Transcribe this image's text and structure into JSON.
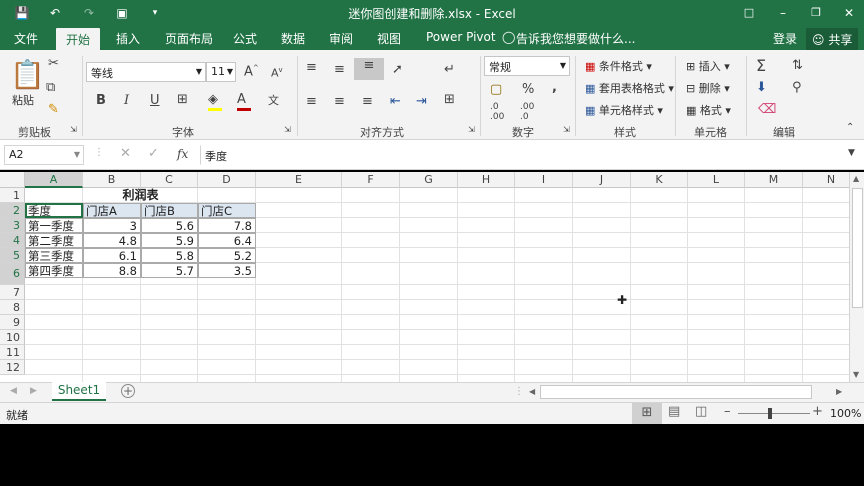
{
  "window": {
    "title": "迷你图创建和删除.xlsx - Excel"
  },
  "tabs": [
    "文件",
    "开始",
    "插入",
    "页面布局",
    "公式",
    "数据",
    "审阅",
    "视图",
    "Power Pivot"
  ],
  "tell_me": "告诉我您想要做什么...",
  "login": "登录",
  "share": "共享",
  "ribbon": {
    "clipboard": {
      "paste": "粘贴",
      "label": "剪贴板"
    },
    "font": {
      "name": "等线",
      "size": "11",
      "label": "字体"
    },
    "alignment": {
      "label": "对齐方式"
    },
    "number": {
      "format": "常规",
      "label": "数字"
    },
    "styles": {
      "conditional": "条件格式",
      "table": "套用表格格式",
      "cell": "单元格样式",
      "label": "样式"
    },
    "cells": {
      "insert": "插入",
      "delete": "删除",
      "format": "格式",
      "label": "单元格"
    },
    "editing": {
      "label": "编辑"
    },
    "colors": {
      "accent": "#217346",
      "font_color": "#c00000",
      "fill_color": "#ffff00"
    }
  },
  "formula_bar": {
    "name_box": "A2",
    "fx": "fx",
    "content": "季度"
  },
  "columns": [
    "A",
    "B",
    "C",
    "D",
    "E",
    "F",
    "G",
    "H",
    "I",
    "J",
    "K",
    "L",
    "M",
    "N"
  ],
  "rows": [
    "1",
    "2",
    "3",
    "4",
    "5",
    "6",
    "7",
    "8",
    "9",
    "10",
    "11",
    "12"
  ],
  "table": {
    "title": "利润表",
    "headers": [
      "季度",
      "门店A",
      "门店B",
      "门店C"
    ],
    "data": [
      [
        "第一季度",
        "3",
        "5.6",
        "7.8"
      ],
      [
        "第二季度",
        "4.8",
        "5.9",
        "6.4"
      ],
      [
        "第三季度",
        "6.1",
        "5.8",
        "5.2"
      ],
      [
        "第四季度",
        "8.8",
        "5.7",
        "3.5"
      ]
    ]
  },
  "sheet_tabs": [
    "Sheet1"
  ],
  "status": {
    "ready": "就绪",
    "zoom": "100%"
  }
}
